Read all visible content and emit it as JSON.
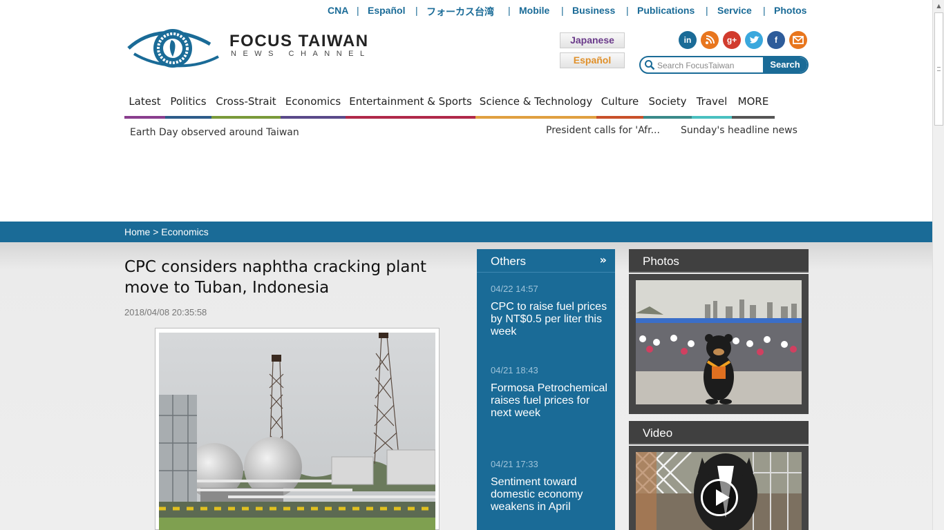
{
  "topnav": {
    "items": [
      "CNA",
      "Español",
      "フォーカス台湾",
      "Mobile",
      "Business",
      "Publications",
      "Service",
      "Photos"
    ],
    "separator": "|"
  },
  "logo": {
    "title": "FOCUS TAIWAN",
    "subtitle": "NEWS CHANNEL"
  },
  "language_buttons": {
    "japanese": "Japanese",
    "spanish": "Español"
  },
  "social_icons": [
    "linkedin-icon",
    "rss-icon",
    "google-plus-icon",
    "twitter-icon",
    "facebook-icon",
    "email-icon"
  ],
  "social_glyphs": [
    "in",
    "",
    "g+",
    "",
    "f",
    ""
  ],
  "search": {
    "placeholder": "Search FocusTaiwan",
    "button_label": "Search"
  },
  "mainnav": {
    "items": [
      {
        "label": "Latest",
        "color": "#8a3e8e"
      },
      {
        "label": "Politics",
        "color": "#2e5c8a"
      },
      {
        "label": "Cross-Strait",
        "color": "#7a9a3a"
      },
      {
        "label": "Economics",
        "color": "#5a4a8a"
      },
      {
        "label": "Entertainment & Sports",
        "color": "#b0294a"
      },
      {
        "label": "Science & Technology",
        "color": "#e0a040"
      },
      {
        "label": "Culture",
        "color": "#c8502a"
      },
      {
        "label": "Society",
        "color": "#3a8a8a"
      },
      {
        "label": "Travel",
        "color": "#4ac0c0"
      },
      {
        "label": "MORE",
        "color": "#555555"
      }
    ]
  },
  "ticker": {
    "left": "Earth Day observed around Taiwan",
    "middle": "President calls for 'Afr...",
    "right": "Sunday's headline news"
  },
  "breadcrumb": {
    "text": "Home > Economics"
  },
  "article": {
    "title": "CPC considers naphtha cracking plant move to Tuban, Indonesia",
    "date": "2018/04/08 20:35:58"
  },
  "others": {
    "title": "Others",
    "arrow": "»",
    "items": [
      {
        "time": "04/22 14:57",
        "headline": "CPC to raise fuel prices by NT$0.5 per liter this week"
      },
      {
        "time": "04/21 18:43",
        "headline": "Formosa Petrochemical raises fuel prices for next week"
      },
      {
        "time": "04/21 17:33",
        "headline": "Sentiment toward domestic economy weakens in April"
      }
    ]
  },
  "photos": {
    "title": "Photos"
  },
  "video": {
    "title": "Video"
  },
  "colors": {
    "brand_blue": "#1a6b97",
    "dark_panel": "#404040"
  }
}
